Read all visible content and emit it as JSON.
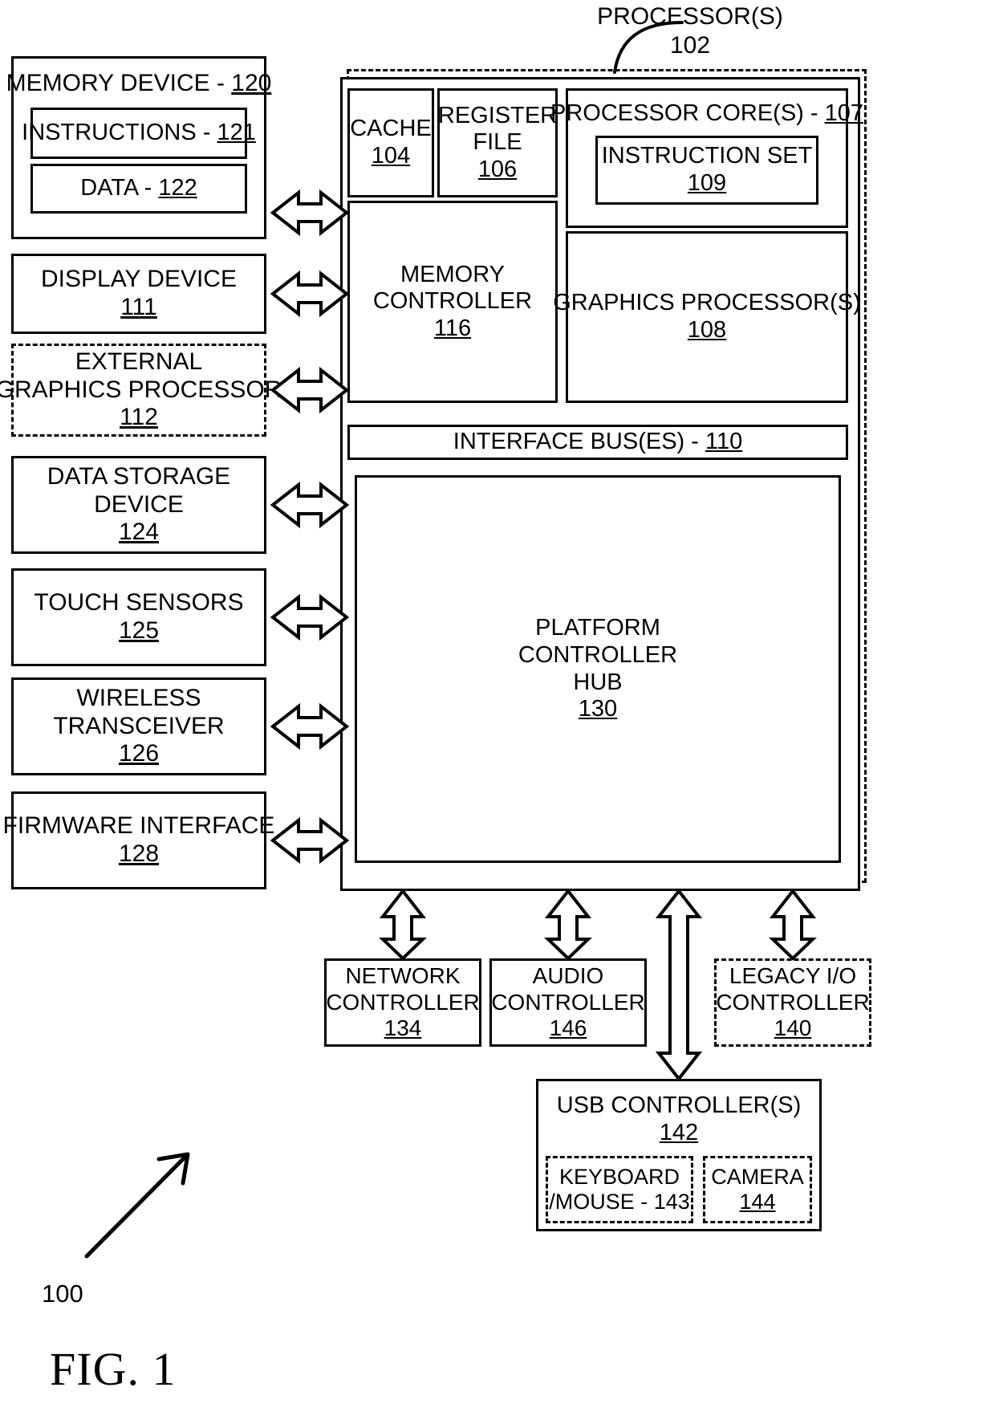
{
  "figure": {
    "caption": "FIG. 1",
    "system_ref": "100",
    "processor_callout": {
      "label": "PROCESSOR(S)",
      "number": "102"
    }
  },
  "left_column": [
    {
      "name": "memory-device",
      "label": "MEMORY DEVICE - ",
      "number": "120",
      "inline": true,
      "dashed": false,
      "children": [
        {
          "name": "instructions",
          "label": "INSTRUCTIONS - ",
          "number": "121",
          "inline": true
        },
        {
          "name": "data",
          "label": "DATA - ",
          "number": "122",
          "inline": true
        }
      ]
    },
    {
      "name": "display-device",
      "lines": [
        "DISPLAY DEVICE"
      ],
      "number": "111",
      "dashed": false
    },
    {
      "name": "external-graphics-processor",
      "lines": [
        "EXTERNAL",
        "GRAPHICS PROCESSOR"
      ],
      "number": "112",
      "dashed": true
    },
    {
      "name": "data-storage-device",
      "lines": [
        "DATA STORAGE",
        "DEVICE"
      ],
      "number": "124",
      "dashed": false
    },
    {
      "name": "touch-sensors",
      "lines": [
        "TOUCH SENSORS"
      ],
      "number": "125",
      "dashed": false
    },
    {
      "name": "wireless-transceiver",
      "lines": [
        "WIRELESS",
        "TRANSCEIVER"
      ],
      "number": "126",
      "dashed": false
    },
    {
      "name": "firmware-interface",
      "lines": [
        "FIRMWARE INTERFACE"
      ],
      "number": "128",
      "dashed": false
    }
  ],
  "processor": {
    "cache": {
      "lines": [
        "CACHE"
      ],
      "number": "104"
    },
    "register_file": {
      "lines": [
        "REGISTER",
        "FILE"
      ],
      "number": "106"
    },
    "processor_cores": {
      "label": "PROCESSOR CORE(S) - ",
      "number": "107"
    },
    "instruction_set": {
      "lines": [
        "INSTRUCTION SET"
      ],
      "number": "109"
    },
    "memory_controller": {
      "lines": [
        "MEMORY",
        "CONTROLLER"
      ],
      "number": "116"
    },
    "graphics_processor": {
      "lines": [
        "GRAPHICS PROCESSOR(S)"
      ],
      "number": "108"
    },
    "interface_bus": {
      "label": "INTERFACE BUS(ES) - ",
      "number": "110"
    }
  },
  "platform_controller_hub": {
    "lines": [
      "PLATFORM",
      "CONTROLLER",
      "HUB"
    ],
    "number": "130"
  },
  "peripherals": [
    {
      "name": "network-controller",
      "lines": [
        "NETWORK",
        "CONTROLLER"
      ],
      "number": "134",
      "dashed": false
    },
    {
      "name": "audio-controller",
      "lines": [
        "AUDIO",
        "CONTROLLER"
      ],
      "number": "146",
      "dashed": false
    },
    {
      "name": "legacy-io-controller",
      "lines": [
        "LEGACY I/O",
        "CONTROLLER"
      ],
      "number": "140",
      "dashed": true
    }
  ],
  "usb": {
    "label": "USB CONTROLLER(S)",
    "number": "142",
    "children": [
      {
        "name": "keyboard-mouse",
        "lines": [
          "KEYBOARD",
          "/MOUSE - 143"
        ],
        "dashed": true
      },
      {
        "name": "camera",
        "lines": [
          "CAMERA"
        ],
        "number": "144",
        "dashed": true
      }
    ]
  }
}
